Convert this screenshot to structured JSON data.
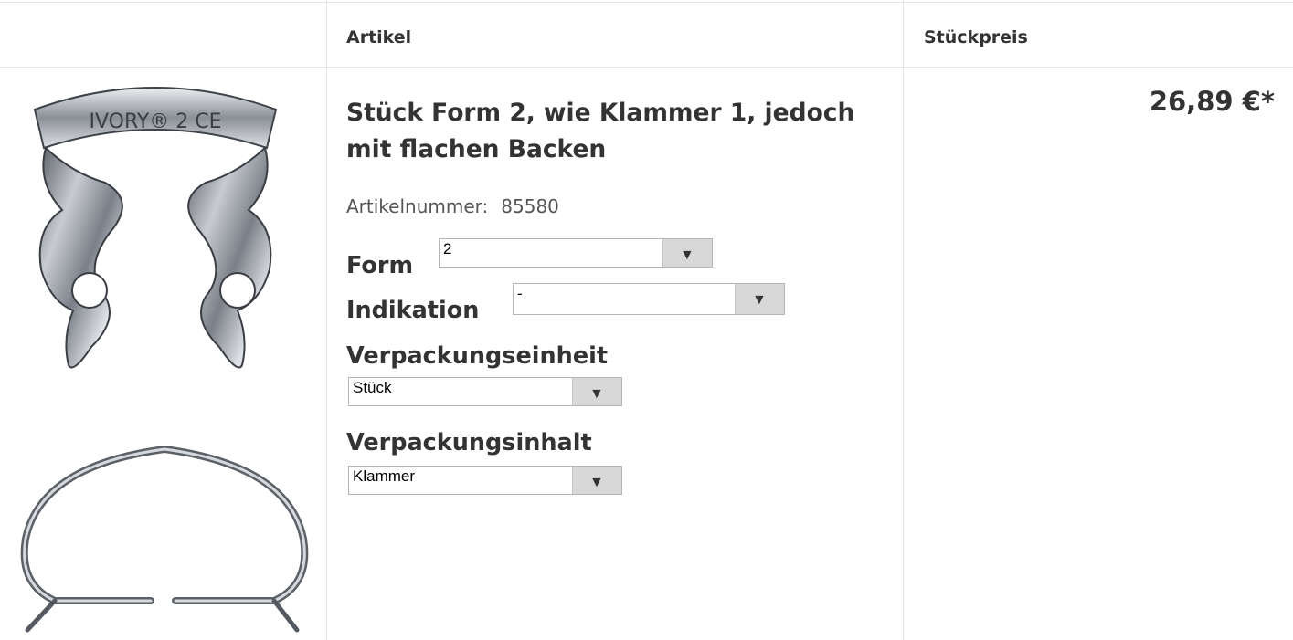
{
  "table": {
    "headers": {
      "article": "Artikel",
      "unit_price": "Stückpreis"
    }
  },
  "product": {
    "title": "Stück Form 2, wie Klammer 1, jedoch mit flachen Backen",
    "article_number_label": "Artikelnummer:",
    "article_number": "85580",
    "price": "26,89 €*",
    "image_text": "IVORY® 2 CE",
    "options": [
      {
        "label": "Form",
        "value": "2"
      },
      {
        "label": "Indikation",
        "value": "-"
      },
      {
        "label": "Verpackungseinheit",
        "value": "Stück"
      },
      {
        "label": "Verpackungsinhalt",
        "value": "Klammer"
      }
    ]
  },
  "icons": {
    "dropdown": "triangle-down-icon"
  }
}
